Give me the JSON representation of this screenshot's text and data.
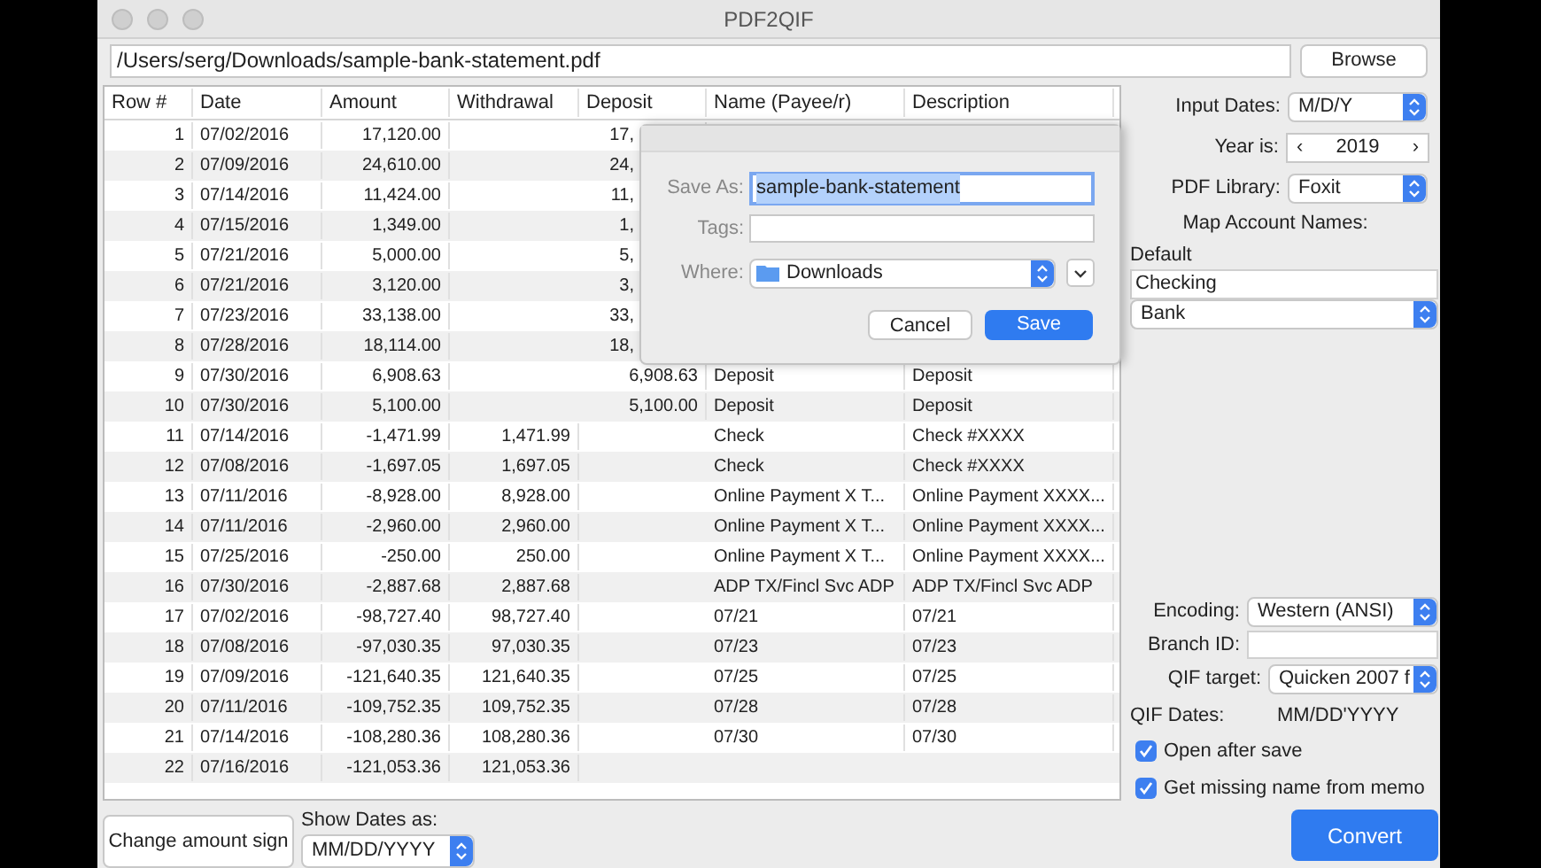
{
  "window": {
    "title": "PDF2QIF"
  },
  "path_field": {
    "value": "/Users/serg/Downloads/sample-bank-statement.pdf"
  },
  "browse_button": "Browse",
  "table": {
    "columns": [
      "Row #",
      "Date",
      "Amount",
      "Withdrawal",
      "Deposit",
      "Name (Payee/r)",
      "Description"
    ],
    "rows": [
      {
        "row": "1",
        "date": "07/02/2016",
        "amount": "17,120.00",
        "withdrawal": "",
        "deposit": "17,",
        "covered": true
      },
      {
        "row": "2",
        "date": "07/09/2016",
        "amount": "24,610.00",
        "withdrawal": "",
        "deposit": "24,",
        "covered": true
      },
      {
        "row": "3",
        "date": "07/14/2016",
        "amount": "11,424.00",
        "withdrawal": "",
        "deposit": "11,",
        "covered": true
      },
      {
        "row": "4",
        "date": "07/15/2016",
        "amount": "1,349.00",
        "withdrawal": "",
        "deposit": "1,",
        "covered": true
      },
      {
        "row": "5",
        "date": "07/21/2016",
        "amount": "5,000.00",
        "withdrawal": "",
        "deposit": "5,",
        "covered": true
      },
      {
        "row": "6",
        "date": "07/21/2016",
        "amount": "3,120.00",
        "withdrawal": "",
        "deposit": "3,",
        "covered": true
      },
      {
        "row": "7",
        "date": "07/23/2016",
        "amount": "33,138.00",
        "withdrawal": "",
        "deposit": "33,",
        "covered": true
      },
      {
        "row": "8",
        "date": "07/28/2016",
        "amount": "18,114.00",
        "withdrawal": "",
        "deposit": "18,",
        "covered": true
      },
      {
        "row": "9",
        "date": "07/30/2016",
        "amount": "6,908.63",
        "withdrawal": "",
        "deposit": "6,908.63",
        "name": "Deposit",
        "description": "Deposit"
      },
      {
        "row": "10",
        "date": "07/30/2016",
        "amount": "5,100.00",
        "withdrawal": "",
        "deposit": "5,100.00",
        "name": "Deposit",
        "description": "Deposit"
      },
      {
        "row": "11",
        "date": "07/14/2016",
        "amount": "-1,471.99",
        "withdrawal": "1,471.99",
        "deposit": "",
        "name": "Check",
        "description": "Check #XXXX"
      },
      {
        "row": "12",
        "date": "07/08/2016",
        "amount": "-1,697.05",
        "withdrawal": "1,697.05",
        "deposit": "",
        "name": "Check",
        "description": "Check #XXXX"
      },
      {
        "row": "13",
        "date": "07/11/2016",
        "amount": "-8,928.00",
        "withdrawal": "8,928.00",
        "deposit": "",
        "name": "Online Payment X T...",
        "description": "Online Payment XXXX..."
      },
      {
        "row": "14",
        "date": "07/11/2016",
        "amount": "-2,960.00",
        "withdrawal": "2,960.00",
        "deposit": "",
        "name": "Online Payment X T...",
        "description": "Online Payment XXXX..."
      },
      {
        "row": "15",
        "date": "07/25/2016",
        "amount": "-250.00",
        "withdrawal": "250.00",
        "deposit": "",
        "name": "Online Payment X T...",
        "description": "Online Payment XXXX..."
      },
      {
        "row": "16",
        "date": "07/30/2016",
        "amount": "-2,887.68",
        "withdrawal": "2,887.68",
        "deposit": "",
        "name": "ADP TX/Fincl Svc ADP",
        "description": "ADP TX/Fincl Svc ADP"
      },
      {
        "row": "17",
        "date": "07/02/2016",
        "amount": "-98,727.40",
        "withdrawal": "98,727.40",
        "deposit": "",
        "name": "07/21",
        "description": "07/21"
      },
      {
        "row": "18",
        "date": "07/08/2016",
        "amount": "-97,030.35",
        "withdrawal": "97,030.35",
        "deposit": "",
        "name": "07/23",
        "description": "07/23"
      },
      {
        "row": "19",
        "date": "07/09/2016",
        "amount": "-121,640.35",
        "withdrawal": "121,640.35",
        "deposit": "",
        "name": "07/25",
        "description": "07/25"
      },
      {
        "row": "20",
        "date": "07/11/2016",
        "amount": "-109,752.35",
        "withdrawal": "109,752.35",
        "deposit": "",
        "name": "07/28",
        "description": "07/28"
      },
      {
        "row": "21",
        "date": "07/14/2016",
        "amount": "-108,280.36",
        "withdrawal": "108,280.36",
        "deposit": "",
        "name": "07/30",
        "description": "07/30"
      },
      {
        "row": "22",
        "date": "07/16/2016",
        "amount": "-121,053.36",
        "withdrawal": "121,053.36",
        "deposit": ""
      }
    ]
  },
  "change_sign_button": "Change amount sign",
  "show_dates": {
    "label": "Show Dates as:",
    "value": "MM/DD/YYYY"
  },
  "settings": {
    "input_dates": {
      "label": "Input Dates:",
      "value": "M/D/Y"
    },
    "year": {
      "label": "Year is:",
      "value": "2019",
      "prev": "‹",
      "next": "›"
    },
    "pdf_library": {
      "label": "PDF Library:",
      "value": "Foxit"
    },
    "map_title": "Map Account Names:",
    "default_label": "Default",
    "account_name": "Checking",
    "account_type": "Bank",
    "encoding": {
      "label": "Encoding:",
      "value": "Western (ANSI)"
    },
    "branch_id": {
      "label": "Branch ID:"
    },
    "qif_target": {
      "label": "QIF target:",
      "value": "Quicken 2007 f"
    },
    "qif_dates": {
      "label": "QIF Dates:",
      "value": "MM/DD'YYYY"
    },
    "checkboxes": [
      {
        "label": "Open after save",
        "checked": true
      },
      {
        "label": "Get missing name from memo",
        "checked": true
      }
    ],
    "convert_button": "Convert"
  },
  "save_dialog": {
    "save_as": {
      "label": "Save As:",
      "value": "sample-bank-statement",
      "selected": true
    },
    "tags": {
      "label": "Tags:"
    },
    "where": {
      "label": "Where:",
      "value": "Downloads"
    },
    "buttons": [
      {
        "label": "Cancel",
        "kind": "secondary"
      },
      {
        "label": "Save",
        "kind": "primary"
      }
    ]
  }
}
